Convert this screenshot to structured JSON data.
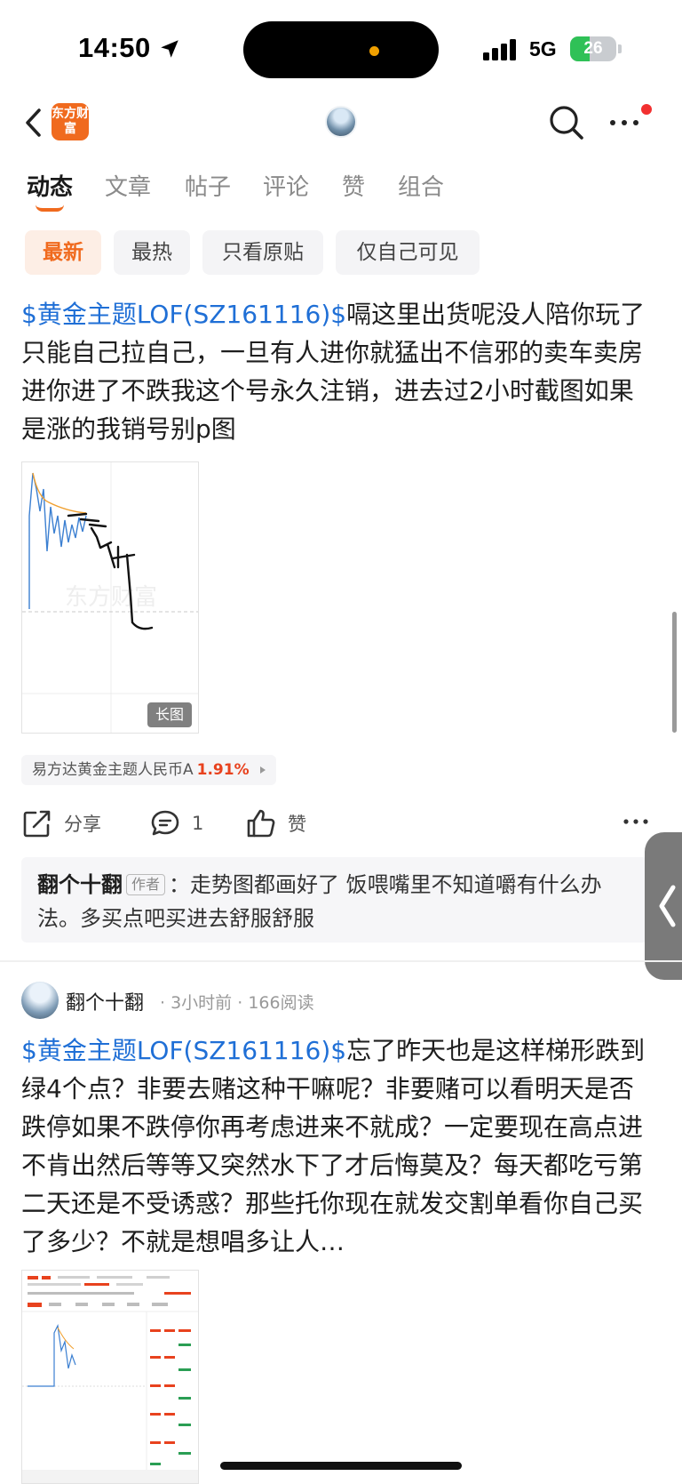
{
  "status_bar": {
    "time": "14:50",
    "network": "5G",
    "battery": "26"
  },
  "nav": {
    "logo_text": "东方财富"
  },
  "tabs": [
    {
      "label": "动态",
      "active": true
    },
    {
      "label": "文章",
      "active": false
    },
    {
      "label": "帖子",
      "active": false
    },
    {
      "label": "评论",
      "active": false
    },
    {
      "label": "赞",
      "active": false
    },
    {
      "label": "组合",
      "active": false
    }
  ],
  "filters": [
    {
      "label": "最新",
      "active": true
    },
    {
      "label": "最热",
      "active": false
    },
    {
      "label": "只看原贴",
      "active": false
    },
    {
      "label": "仅自己可见",
      "active": false
    }
  ],
  "post1": {
    "stock_tag": "$黄金主题LOF(SZ161116)$",
    "text": "嗝这里出货呢没人陪你玩了只能自己拉自己，一旦有人进你就猛出不信邪的卖车卖房进你进了不跌我这个号永久注销，进去过2小时截图如果是涨的我销号别p图",
    "image_badge": "长图",
    "image_watermark": "东方财富",
    "fund_name": "易方达黄金主题人民币A",
    "fund_change": "1.91%",
    "actions": {
      "share": "分享",
      "comment_count": "1",
      "like": "赞"
    },
    "comment": {
      "author": "翻个十翻",
      "badge": "作者",
      "separator": "：",
      "text": "走势图都画好了 饭喂嘴里不知道嚼有什么办法。多买点吧买进去舒服舒服"
    }
  },
  "post2": {
    "author": "翻个十翻",
    "time": "3小时前",
    "reads": "166阅读",
    "stock_tag": "$黄金主题LOF(SZ161116)$",
    "text": "忘了昨天也是这样梯形跌到绿4个点？非要去赌这种干嘛呢？非要赌可以看明天是否跌停如果不跌停你再考虑进来不就成？一定要现在高点进不肯出然后等等又突然水下了才后悔莫及？每天都吃亏第二天还是不受诱惑？那些托你现在就发交割单看你自己买了多少？不就是想唱多让人…"
  },
  "colors": {
    "accent": "#f06a1e",
    "link": "#1f6fd6",
    "up": "#e8421e"
  }
}
